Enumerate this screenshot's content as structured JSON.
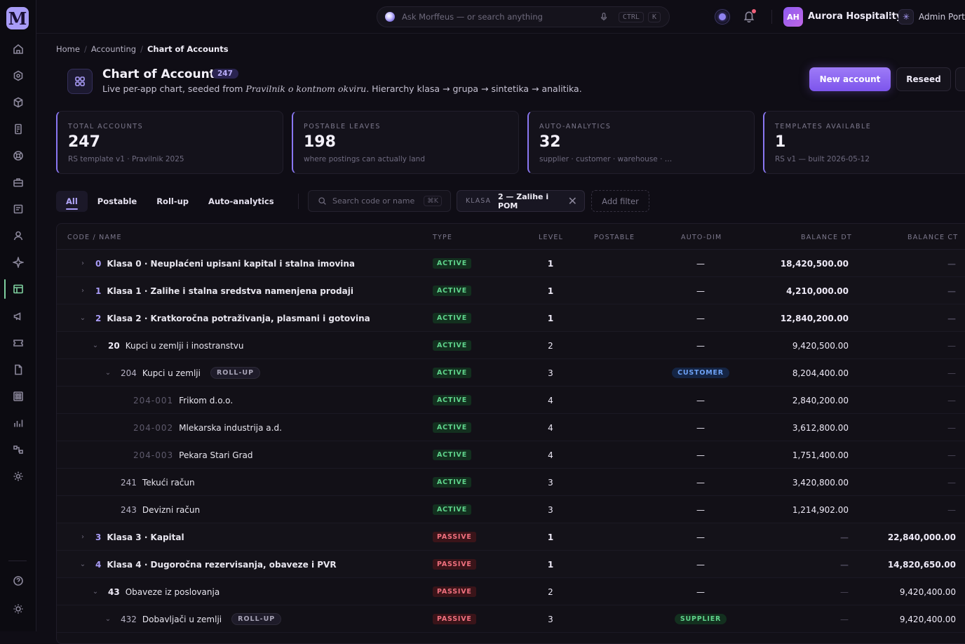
{
  "app": {
    "logo_letter": "M",
    "accent": "#8a77f2"
  },
  "search": {
    "placeholder": "Ask Morffeus — or search anything",
    "kbd1": "CTRL",
    "kbd2": "K"
  },
  "org": {
    "initials": "AH",
    "name": "Aurora Hospitality",
    "portal": "Admin Portal"
  },
  "breadcrumb": {
    "home": "Home",
    "section": "Accounting",
    "current": "Chart of Accounts"
  },
  "header": {
    "title": "Chart of Accounts",
    "count": "247",
    "sub_pre": "Live per-app chart, seeded from ",
    "sub_em": "Pravilnik o kontnom okviru",
    "sub_post": ". Hierarchy klasa → grupa → sintetika → analitika.",
    "new_button": "New account",
    "reseed_button": "Reseed"
  },
  "stats": [
    {
      "label": "TOTAL ACCOUNTS",
      "value": "247",
      "sub": "RS template v1 · Pravilnik 2025"
    },
    {
      "label": "POSTABLE LEAVES",
      "value": "198",
      "sub": "where postings can actually land"
    },
    {
      "label": "AUTO-ANALYTICS",
      "value": "32",
      "sub": "supplier · customer · warehouse · …"
    },
    {
      "label": "TEMPLATES AVAILABLE",
      "value": "1",
      "sub": "RS v1 — built 2026-05-12"
    }
  ],
  "tabs": [
    "All",
    "Postable",
    "Roll-up",
    "Auto-analytics"
  ],
  "filter": {
    "search_placeholder": "Search code or name",
    "search_kbd": "⌘K",
    "chip_key": "KLASA",
    "chip_value": "2 — Zalihe i POM",
    "add_filter": "Add filter"
  },
  "table": {
    "headers": {
      "code": "CODE / NAME",
      "type": "TYPE",
      "level": "LEVEL",
      "postable": "POSTABLE",
      "autodim": "AUTO-DIM",
      "dt": "BALANCE DT",
      "ct": "BALANCE CT"
    },
    "rows": [
      {
        "chev": "›",
        "code": "0",
        "name": "Klasa 0 · Neuplaćeni upisani kapital i stalna imovina",
        "type": "ACTIVE",
        "level": "1",
        "dim": "—",
        "dt": "18,420,500.00",
        "ct": "—"
      },
      {
        "chev": "›",
        "code": "1",
        "name": "Klasa 1 · Zalihe i stalna sredstva namenjena prodaji",
        "type": "ACTIVE",
        "level": "1",
        "dim": "—",
        "dt": "4,210,000.00",
        "ct": "—"
      },
      {
        "chev": "⌄",
        "code": "2",
        "name": "Klasa 2 · Kratkoročna potraživanja, plasmani i gotovina",
        "type": "ACTIVE",
        "level": "1",
        "dim": "—",
        "dt": "12,840,200.00",
        "ct": "—"
      },
      {
        "chev": "⌄",
        "code": "20",
        "name": "Kupci u zemlji i inostranstvu",
        "type": "ACTIVE",
        "level": "2",
        "dim": "—",
        "dt": "9,420,500.00",
        "ct": "—"
      },
      {
        "chev": "⌄",
        "code": "204",
        "name": "Kupci u zemlji",
        "tag": "ROLL-UP",
        "type": "ACTIVE",
        "level": "3",
        "dim": "CUSTOMER",
        "dt": "8,204,400.00",
        "ct": "—"
      },
      {
        "chev": "",
        "code": "204-001",
        "name": "Frikom d.o.o.",
        "type": "ACTIVE",
        "level": "4",
        "dim": "—",
        "dt": "2,840,200.00",
        "ct": "—"
      },
      {
        "chev": "",
        "code": "204-002",
        "name": "Mlekarska industrija a.d.",
        "type": "ACTIVE",
        "level": "4",
        "dim": "—",
        "dt": "3,612,800.00",
        "ct": "—"
      },
      {
        "chev": "",
        "code": "204-003",
        "name": "Pekara Stari Grad",
        "type": "ACTIVE",
        "level": "4",
        "dim": "—",
        "dt": "1,751,400.00",
        "ct": "—"
      },
      {
        "chev": "",
        "code": "241",
        "name": "Tekući račun",
        "type": "ACTIVE",
        "level": "3",
        "dim": "—",
        "dt": "3,420,800.00",
        "ct": "—"
      },
      {
        "chev": "",
        "code": "243",
        "name": "Devizni račun",
        "type": "ACTIVE",
        "level": "3",
        "dim": "—",
        "dt": "1,214,902.00",
        "ct": "—"
      },
      {
        "chev": "›",
        "code": "3",
        "name": "Klasa 3 · Kapital",
        "type": "PASSIVE",
        "level": "1",
        "dim": "—",
        "dt": "—",
        "ct": "22,840,000.00"
      },
      {
        "chev": "⌄",
        "code": "4",
        "name": "Klasa 4 · Dugoročna rezervisanja, obaveze i PVR",
        "type": "PASSIVE",
        "level": "1",
        "dim": "—",
        "dt": "—",
        "ct": "14,820,650.00"
      },
      {
        "chev": "⌄",
        "code": "43",
        "name": "Obaveze iz poslovanja",
        "type": "PASSIVE",
        "level": "2",
        "dim": "—",
        "dt": "—",
        "ct": "9,420,400.00"
      },
      {
        "chev": "⌄",
        "code": "432",
        "name": "Dobavljači u zemlji",
        "tag": "ROLL-UP",
        "type": "PASSIVE",
        "level": "3",
        "dim": "SUPPLIER",
        "dt": "—",
        "ct": "9,420,400.00"
      }
    ]
  }
}
